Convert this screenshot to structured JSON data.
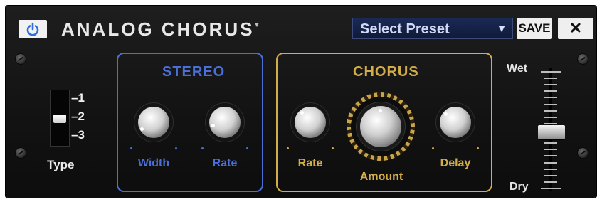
{
  "header": {
    "title": "ANALOG CHORUS",
    "preset_label": "Select Preset",
    "save_label": "SAVE",
    "close_label": "✕"
  },
  "type": {
    "label": "Type",
    "options": [
      "1",
      "2",
      "3"
    ],
    "selected": "2"
  },
  "stereo": {
    "title": "STEREO",
    "knobs": [
      {
        "label": "Width"
      },
      {
        "label": "Rate"
      }
    ]
  },
  "chorus": {
    "title": "CHORUS",
    "knobs": [
      {
        "label": "Rate"
      },
      {
        "label": "Amount"
      },
      {
        "label": "Delay"
      }
    ]
  },
  "mix": {
    "top_label": "Wet",
    "bottom_label": "Dry"
  },
  "colors": {
    "stereo": "#4a6fd8",
    "chorus": "#d3ad4a",
    "panel": "#161616"
  },
  "icons": {
    "power": "power-icon",
    "preset_dropdown": "chevron-down-icon",
    "title_dropdown": "caret-down-icon",
    "close": "close-icon"
  }
}
